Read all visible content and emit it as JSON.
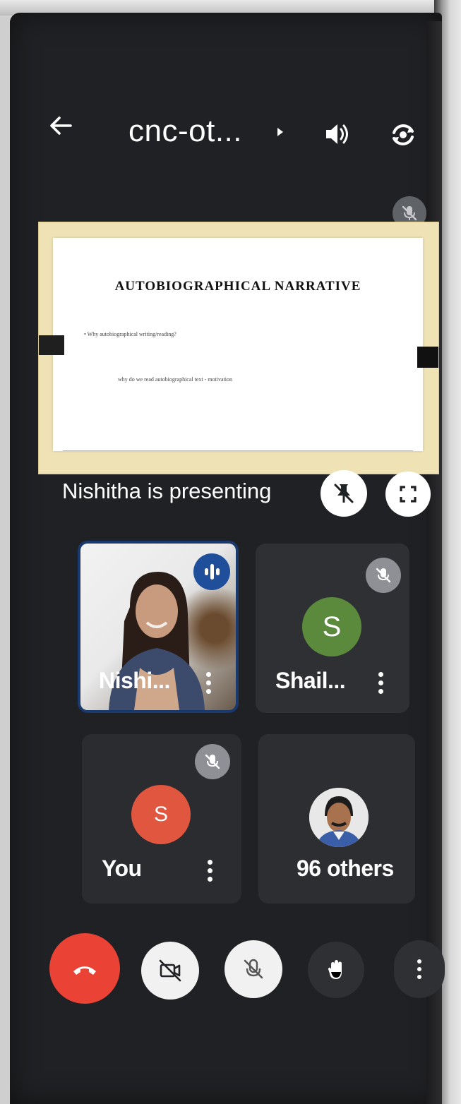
{
  "header": {
    "meeting_title": "cnc-ot...",
    "icons": [
      "back-arrow-icon",
      "dropdown-arrow-icon",
      "speaker-icon",
      "switch-camera-icon"
    ]
  },
  "presentation": {
    "slide_title": "AUTOBIOGRAPHICAL NARRATIVE",
    "slide_bullet": "• Why autobiographical writing/reading?",
    "slide_subtext": "why do we read autobiographical text - motivation",
    "presenting_label": "Nishitha is presenting"
  },
  "tiles": [
    {
      "name": "Nishi...",
      "state": "speaking",
      "video": true
    },
    {
      "name": "Shail...",
      "initial": "S",
      "avatar_color": "#5b8a3c",
      "muted": true
    },
    {
      "name": "You",
      "initial": "S",
      "avatar_color": "#e0563f",
      "muted": true
    },
    {
      "name": "96 others"
    }
  ],
  "controls": {
    "icons": [
      "end-call-icon",
      "camera-off-icon",
      "mic-off-icon",
      "raise-hand-icon",
      "more-options-icon"
    ]
  },
  "colors": {
    "background": "#202124",
    "end_call": "#ea4335",
    "speaking_badge": "#1f4f9a"
  }
}
